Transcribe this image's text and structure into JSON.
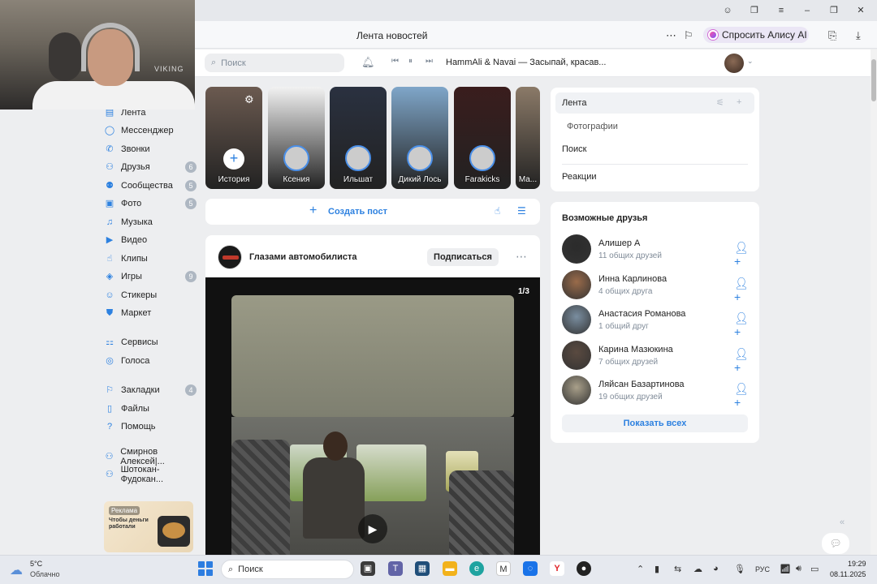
{
  "browser": {
    "page_title": "Лента новостей",
    "alice_label": "Спросить Алису AI"
  },
  "header": {
    "search_placeholder": "Поиск",
    "now_playing": "HammAli & Navai — Засыпай, красав..."
  },
  "webcam": {
    "shirt_text": "VIKING"
  },
  "sidebar": {
    "items": [
      {
        "label": "Лента",
        "icon": "feed-icon"
      },
      {
        "label": "Мессенджер",
        "icon": "messenger-icon"
      },
      {
        "label": "Звонки",
        "icon": "phone-icon"
      },
      {
        "label": "Друзья",
        "icon": "friends-icon",
        "badge": "6"
      },
      {
        "label": "Сообщества",
        "icon": "communities-icon",
        "badge": "5"
      },
      {
        "label": "Фото",
        "icon": "photo-icon",
        "badge": "5"
      },
      {
        "label": "Музыка",
        "icon": "music-icon"
      },
      {
        "label": "Видео",
        "icon": "video-icon"
      },
      {
        "label": "Клипы",
        "icon": "clips-icon"
      },
      {
        "label": "Игры",
        "icon": "games-icon",
        "badge": "9"
      },
      {
        "label": "Стикеры",
        "icon": "stickers-icon"
      },
      {
        "label": "Маркет",
        "icon": "market-icon"
      },
      {
        "label": "Сервисы",
        "icon": "services-icon"
      },
      {
        "label": "Голоса",
        "icon": "voices-icon"
      },
      {
        "label": "Закладки",
        "icon": "bookmark-icon",
        "badge": "4"
      },
      {
        "label": "Файлы",
        "icon": "files-icon"
      },
      {
        "label": "Помощь",
        "icon": "help-icon"
      },
      {
        "label": "Смирнов Алексей|...",
        "icon": "group-icon"
      },
      {
        "label": "Шотокан-Фудокан...",
        "icon": "group-icon"
      }
    ],
    "ad": {
      "label": "Реклама",
      "text": "Чтобы деньги работали"
    }
  },
  "stories": [
    {
      "name": "История",
      "bg": "#6b5a50"
    },
    {
      "name": "Ксения",
      "bg": "#f2f2f2"
    },
    {
      "name": "Ильшат",
      "bg": "#2a3140"
    },
    {
      "name": "Дикий Лось",
      "bg": "#7fa6c9"
    },
    {
      "name": "Farakicks",
      "bg": "#3a1d1d"
    },
    {
      "name": "Ma...",
      "bg": "#8b7a68"
    }
  ],
  "create_post": {
    "label": "Создать пост"
  },
  "post": {
    "author": "Глазами автомобилиста",
    "subscribe": "Подписаться",
    "counter": "1/3"
  },
  "right_menu": {
    "items": [
      "Лента",
      "Фотографии",
      "Поиск",
      "Реакции"
    ]
  },
  "friends": {
    "title": "Возможные друзья",
    "show_all": "Показать всех",
    "list": [
      {
        "name": "Алишер А",
        "mutual": "11 общих друзей",
        "color": "#2b2b2b"
      },
      {
        "name": "Инна Карлинова",
        "mutual": "4 общих друга",
        "color": "#9a6b4a"
      },
      {
        "name": "Анастасия Романова",
        "mutual": "1 общий друг",
        "color": "#7a8ea0"
      },
      {
        "name": "Карина Мазюкина",
        "mutual": "7 общих друзей",
        "color": "#5a4a40"
      },
      {
        "name": "Ляйсан Базартинова",
        "mutual": "19 общих друзей",
        "color": "#a9a08a"
      }
    ]
  },
  "taskbar": {
    "temp": "5°C",
    "weather": "Облачно",
    "search": "Поиск",
    "lang": "РУС",
    "time": "19:29",
    "date": "08.11.2025"
  }
}
